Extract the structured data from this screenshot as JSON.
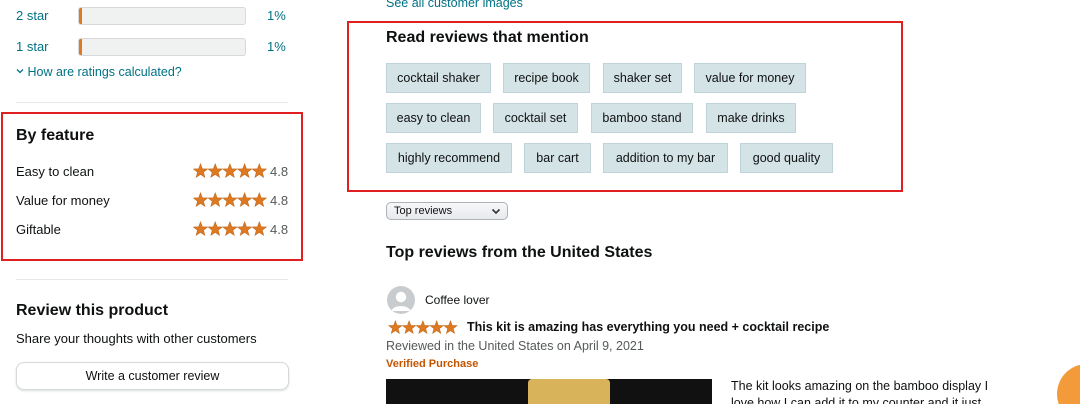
{
  "ratings": {
    "rows": [
      {
        "label": "2 star",
        "percent_text": "1%",
        "fill_fraction": 0.01
      },
      {
        "label": "1 star",
        "percent_text": "1%",
        "fill_fraction": 0.01
      }
    ],
    "how_calculated": "How are ratings calculated?"
  },
  "by_feature": {
    "title": "By feature",
    "items": [
      {
        "name": "Easy to clean",
        "score": "4.8",
        "stars": 5
      },
      {
        "name": "Value for money",
        "score": "4.8",
        "stars": 5
      },
      {
        "name": "Giftable",
        "score": "4.8",
        "stars": 5
      }
    ]
  },
  "review_product": {
    "title": "Review this product",
    "subtitle": "Share your thoughts with other customers",
    "button": "Write a customer review"
  },
  "see_all_images": "See all customer images",
  "mentions": {
    "title": "Read reviews that mention",
    "chips": [
      "cocktail shaker",
      "recipe book",
      "shaker set",
      "value for money",
      "easy to clean",
      "cocktail set",
      "bamboo stand",
      "make drinks",
      "highly recommend",
      "bar cart",
      "addition to my bar",
      "good quality"
    ]
  },
  "sort": {
    "selected": "Top reviews"
  },
  "top_reviews_title": "Top reviews from the United States",
  "review": {
    "author": "Coffee lover",
    "stars": 5,
    "headline": "This kit is amazing has everything you need + cocktail recipe",
    "meta": "Reviewed in the United States on April 9, 2021",
    "verified": "Verified Purchase",
    "body_line1": "The kit looks amazing on the bamboo display I",
    "body_line2": "love how I can add it to my counter and it just"
  },
  "colors": {
    "link": "#007185",
    "star": "#de7921",
    "highlight_box": "#e02020",
    "chip_bg": "#d4e3e6",
    "verified": "#c45500"
  }
}
